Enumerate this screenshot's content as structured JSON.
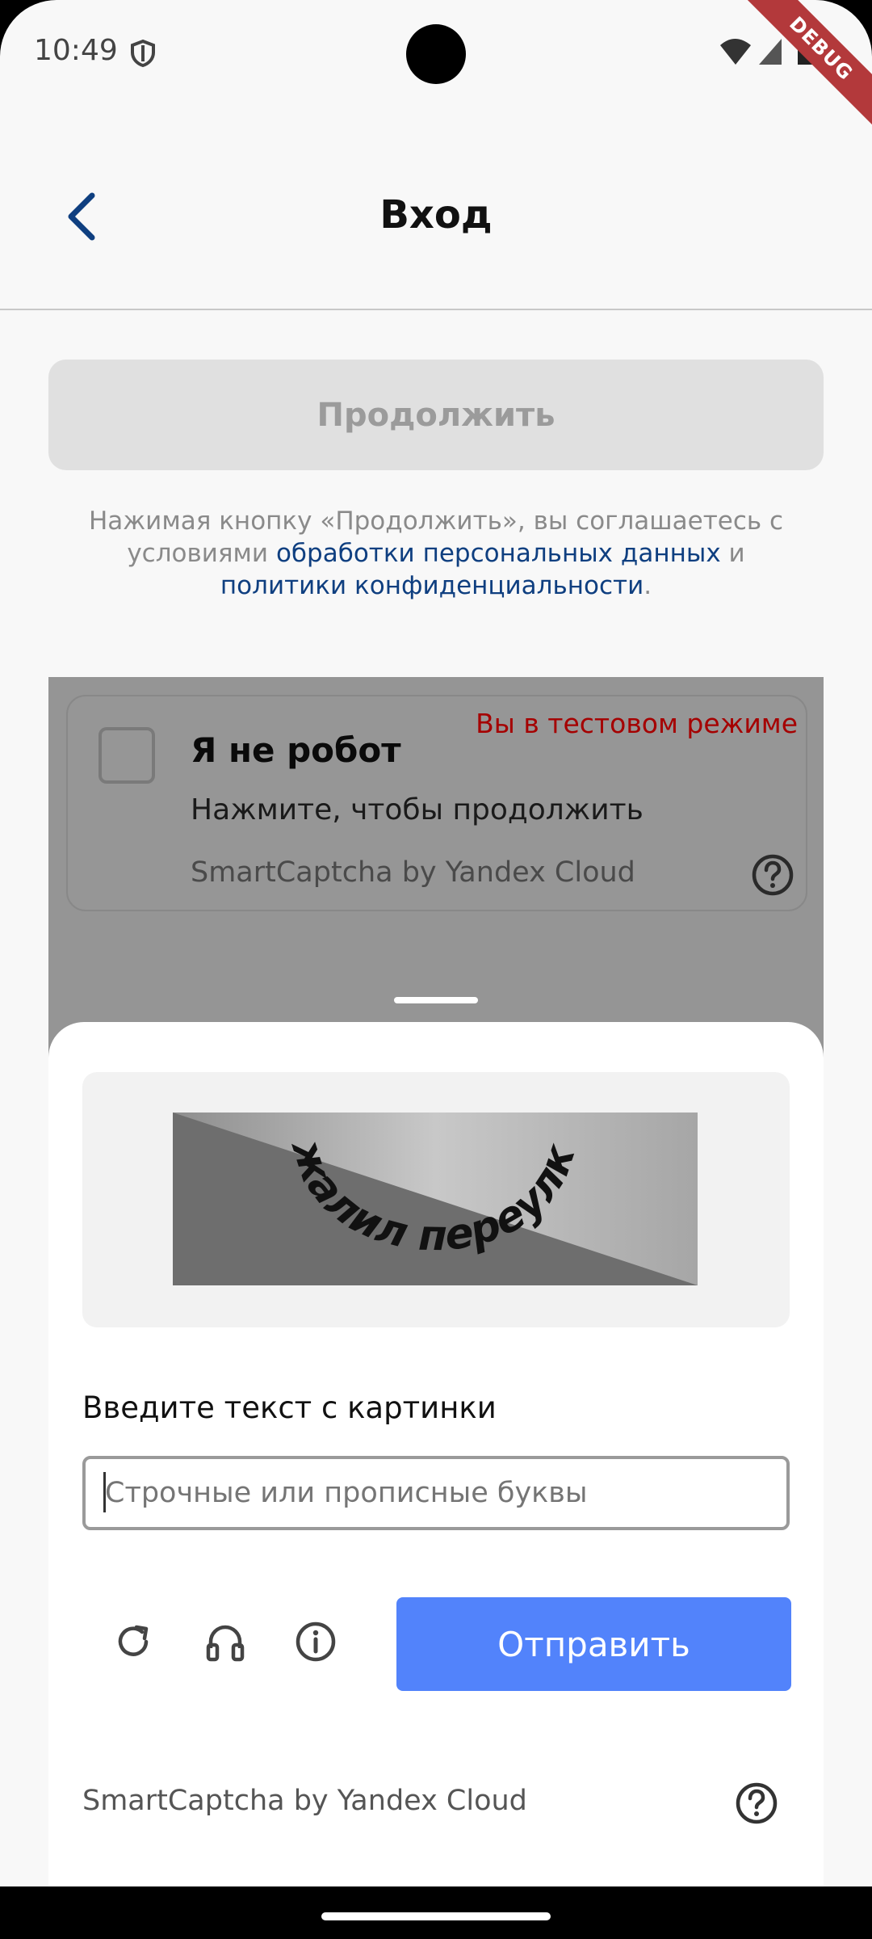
{
  "status_bar": {
    "time": "10:49",
    "left_icons": [
      "shield-icon"
    ],
    "right_icons": [
      "wifi-icon",
      "signal-icon",
      "battery-icon"
    ],
    "debug_label": "DEBUG"
  },
  "app_bar": {
    "back_icon": "chevron-left-icon",
    "title": "Вход"
  },
  "login": {
    "continue_label": "Продолжить",
    "terms_prefix": "Нажимая кнопку «Продолжить», вы соглашаетесь с условиями ",
    "terms_link_1": "обработки персональных данных",
    "terms_middle": " и ",
    "terms_link_2": "политики конфиденциальности",
    "terms_suffix": "."
  },
  "captcha_widget": {
    "title": "Я не робот",
    "subtitle": "Нажмите, чтобы продолжить",
    "test_mode": "Вы в тестовом режиме",
    "brand": "SmartCaptcha by Yandex Cloud",
    "help_icon": "question-circle-icon"
  },
  "captcha_sheet": {
    "image_text": "жалил переулка",
    "input_label": "Введите текст с картинки",
    "input_placeholder": "Строчные или прописные буквы",
    "input_value": "",
    "actions": [
      "refresh-icon",
      "headphones-icon",
      "info-icon"
    ],
    "submit_label": "Отправить",
    "brand": "SmartCaptcha by Yandex Cloud"
  },
  "colors": {
    "accent_blue": "#5283fb",
    "link_blue": "#0f3f80",
    "test_mode_red": "#a50000",
    "debug_ribbon": "#b3393b"
  }
}
